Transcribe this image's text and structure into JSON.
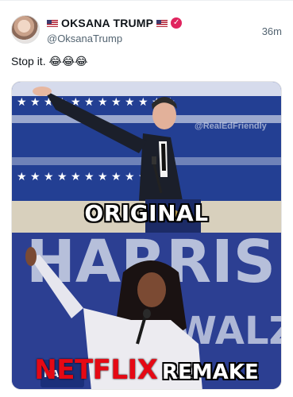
{
  "post": {
    "display_name": "OKSANA TRUMP",
    "handle": "@OksanaTrump",
    "timestamp": "36m",
    "text": "Stop it. 😂😂😂"
  },
  "media": {
    "top_caption": "ORIGINAL",
    "bottom_caption_red": "NETFLIX",
    "bottom_caption_white": "REMAKE",
    "watermark": "@RealEdFriendly",
    "sign_text": "HARRIS",
    "sign_text_2": "WALZ",
    "sign_text_small": "HA"
  },
  "colors": {
    "verified": "#e0245e",
    "netflix_red": "#e50914",
    "flag_blue": "#1e3a8a"
  },
  "icons": [
    "us-flag-icon",
    "verified-badge-icon"
  ]
}
